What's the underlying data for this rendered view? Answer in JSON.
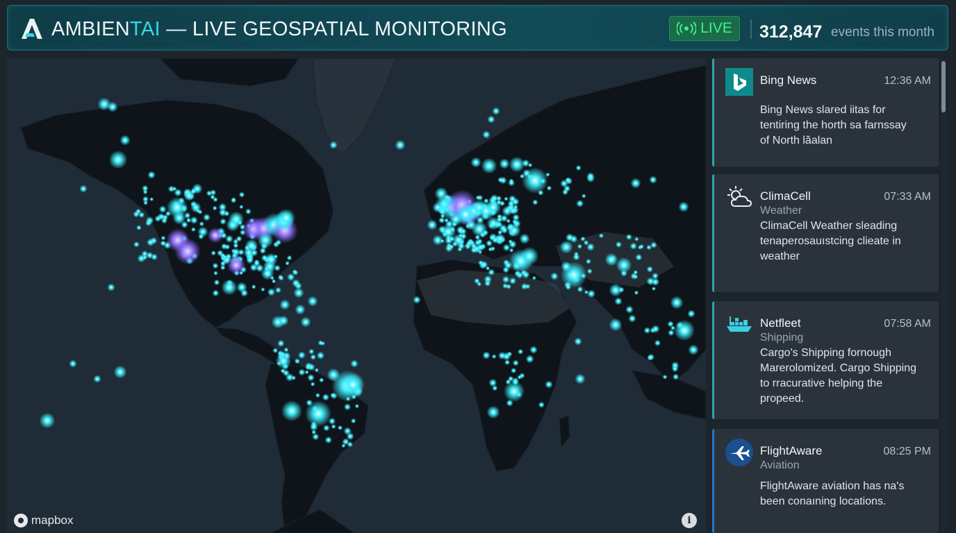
{
  "header": {
    "brand_prefix": "AMBIEN",
    "brand_accent": "TAI",
    "title_rest": " — LIVE GEOSPATIAL MONITORING",
    "live_label": "LIVE",
    "events_count": "312,847",
    "events_label": "events this month"
  },
  "map": {
    "attribution": "mapbox",
    "info_label": "i",
    "hotspot_colors": {
      "cyan": "#3ff0ff",
      "violet": "#9a7bff"
    }
  },
  "feed": {
    "items": [
      {
        "source": "Bing News",
        "category": "",
        "time": "12:36 AM",
        "icon": "bing-icon",
        "body": [
          "Bing News slared iitas for",
          "tentiring the horth sa farnssay",
          "of North lăalan"
        ]
      },
      {
        "source": "ClimaCell",
        "category": "Weather",
        "time": "07:33 AM",
        "icon": "weather-icon",
        "body": [
          "ClimaCell Weather sleading",
          "tenaperosauıstcing clieate in",
          "weather"
        ]
      },
      {
        "source": "Netfleet",
        "category": "Shipping",
        "time": "07:58 AM",
        "icon": "ship-icon",
        "body": [
          "Cargo's Shipping fornough",
          "Marerolomized. Cargo Shipping",
          "to rracurative helping the",
          "propeed."
        ]
      },
      {
        "source": "FlightAware",
        "category": "Aviation",
        "time": "08:25 PM",
        "icon": "airplane-icon",
        "body": [
          "FlightAware aviation has na's",
          "been conaıning locations."
        ]
      }
    ]
  }
}
